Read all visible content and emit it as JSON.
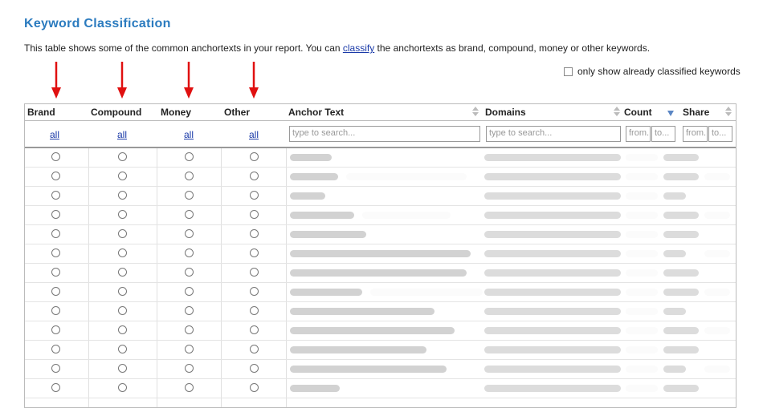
{
  "title": "Keyword Classification",
  "description": {
    "before": "This table shows some of the common anchortexts in your report. You can ",
    "link": "classify",
    "after": " the anchortexts as brand, compound, money or other keywords."
  },
  "only_show_label": "only show already classified keywords",
  "columns": {
    "brand": "Brand",
    "compound": "Compound",
    "money": "Money",
    "other": "Other",
    "anchor_text": "Anchor Text",
    "domains": "Domains",
    "count": "Count",
    "share": "Share"
  },
  "filters": {
    "all": "all",
    "search_placeholder": "type to search...",
    "from": "from.",
    "to": "to..."
  },
  "colors": {
    "title": "#2b7bbf",
    "link": "#1a3aa8",
    "arrow": "#e01010"
  },
  "row_count": 13
}
